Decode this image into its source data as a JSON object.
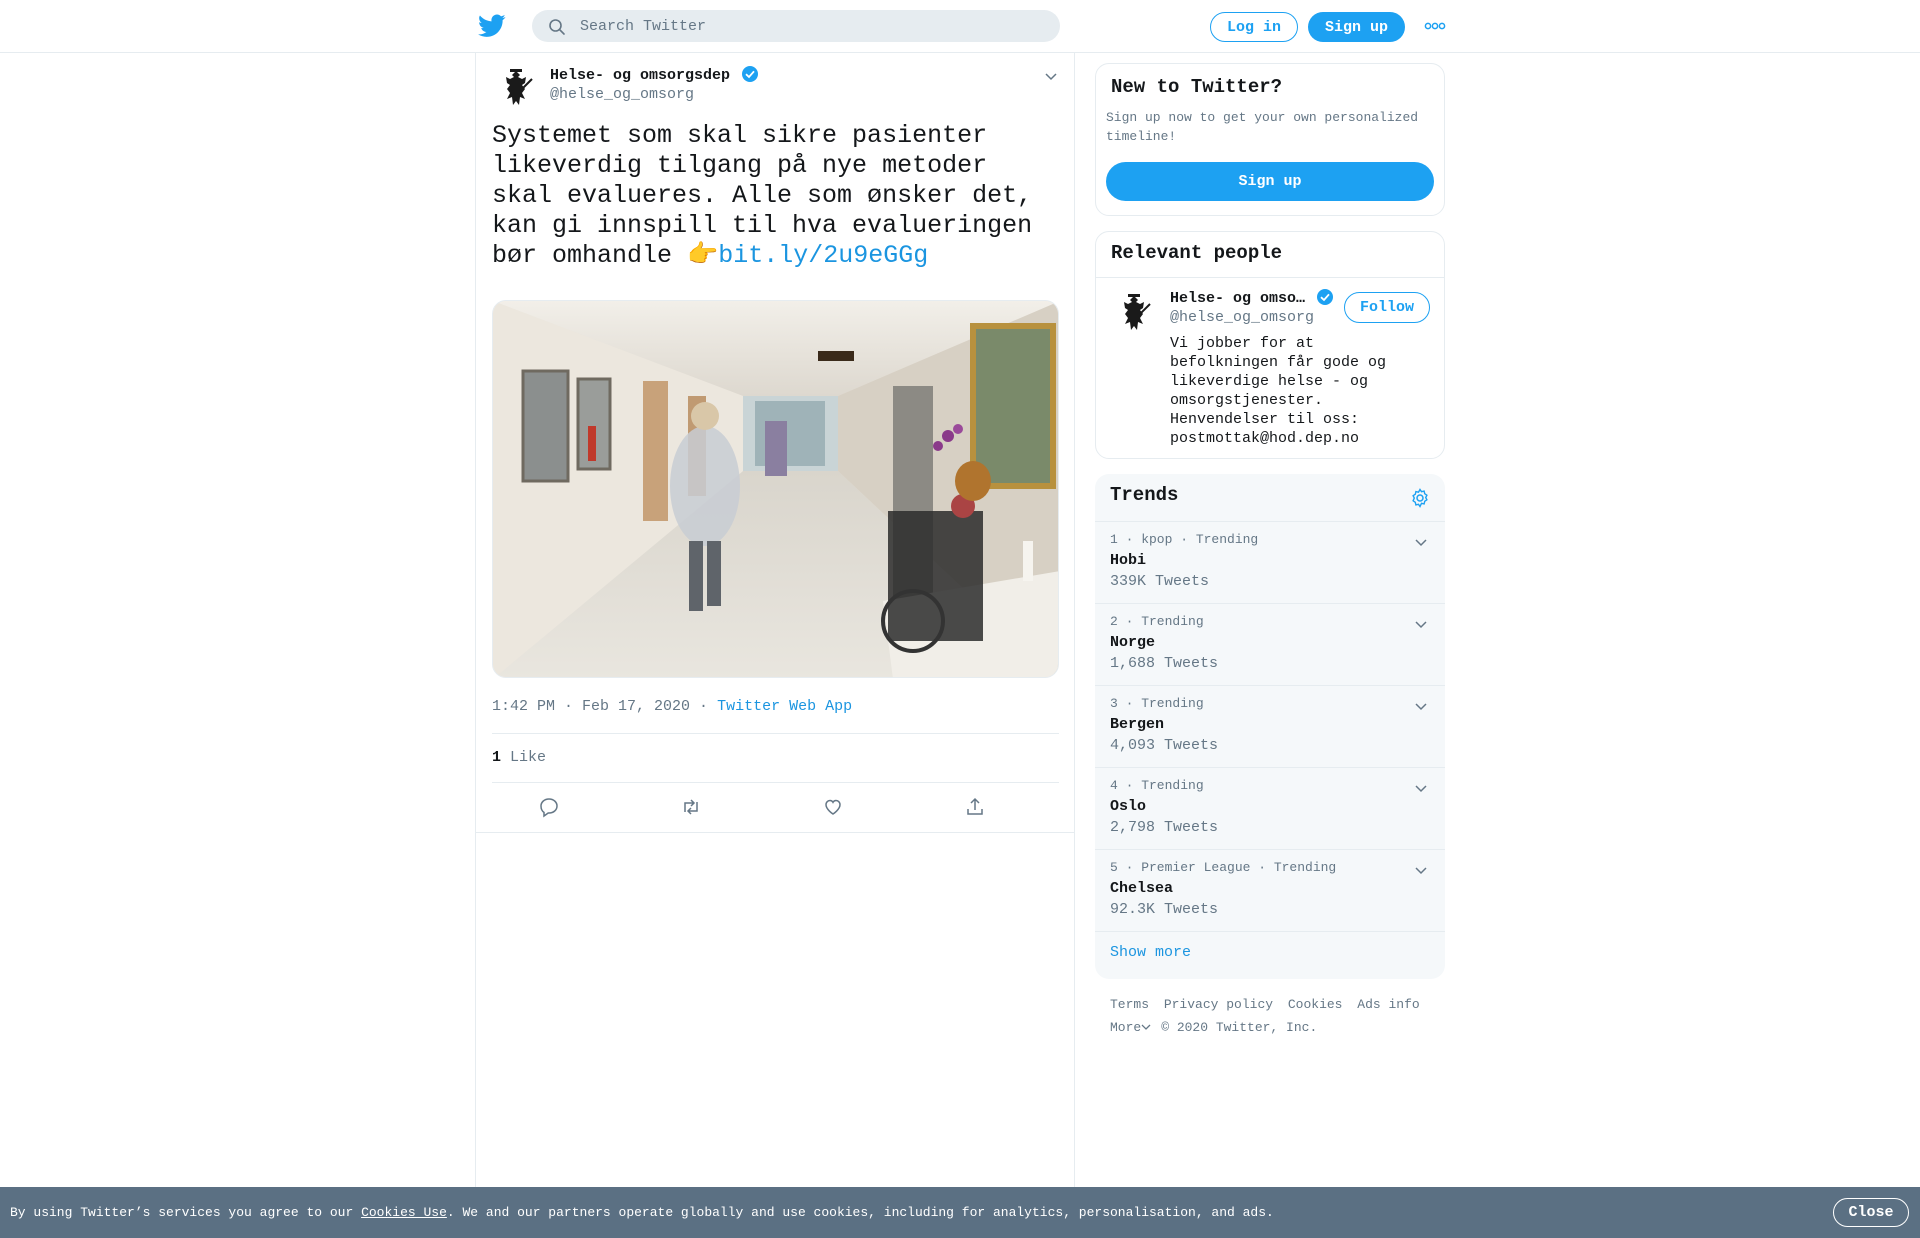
{
  "header": {
    "search_placeholder": "Search Twitter",
    "login_label": "Log in",
    "signup_label": "Sign up",
    "brand_color": "#1da1f2"
  },
  "tweet": {
    "author_name": "Helse- og omsorgsdep",
    "author_handle": "@helse_og_omsorg",
    "text": "Systemet som skal sikre pasienter likeverdig tilgang på nye metoder skal evalueres. Alle som ønsker det, kan gi innspill til hva evalueringen bør omhandle ",
    "emoji": "👉",
    "link": "bit.ly/2u9eGGg",
    "time": "1:42 PM · Feb 17, 2020",
    "separator": " · ",
    "source": "Twitter Web App",
    "like_count": "1",
    "like_label": "Like"
  },
  "sidebar": {
    "new_to_twitter": {
      "title": "New to Twitter?",
      "subtitle": "Sign up now to get your own personalized timeline!",
      "signup_label": "Sign up"
    },
    "relevant_people": {
      "title": "Relevant people",
      "name": "Helse- og omso…",
      "handle": "@helse_og_omsorg",
      "follow_label": "Follow",
      "bio": "Vi jobber for at befolkningen får gode og likeverdige helse - og omsorgstjenester. Henvendelser til oss: postmottak@hod.dep.no"
    },
    "trends": {
      "title": "Trends",
      "items": [
        {
          "meta": "1 · kpop · Trending",
          "name": "Hobi",
          "count": "339K Tweets"
        },
        {
          "meta": "2 · Trending",
          "name": "Norge",
          "count": "1,688 Tweets"
        },
        {
          "meta": "3 · Trending",
          "name": "Bergen",
          "count": "4,093 Tweets"
        },
        {
          "meta": "4 · Trending",
          "name": "Oslo",
          "count": "2,798 Tweets"
        },
        {
          "meta": "5 · Premier League · Trending",
          "name": "Chelsea",
          "count": "92.3K Tweets"
        }
      ],
      "show_more": "Show more"
    },
    "footer": {
      "links": [
        "Terms",
        "Privacy policy",
        "Cookies",
        "Ads info"
      ],
      "more": "More",
      "copyright": "© 2020 Twitter, Inc."
    }
  },
  "cookie_bar": {
    "prefix": "By using Twitter’s services you agree to our ",
    "link": "Cookies Use",
    "suffix": ". We and our partners operate globally and use cookies, including for analytics, personalisation, and ads.",
    "close_label": "Close"
  },
  "icons": {
    "logo": "twitter-bird-icon",
    "search": "search-icon",
    "more": "more-dots-icon",
    "verified": "verified-badge-icon",
    "caret": "chevron-down-icon",
    "reply": "reply-icon",
    "retweet": "retweet-icon",
    "like": "heart-icon",
    "share": "share-icon",
    "settings": "gear-icon"
  }
}
